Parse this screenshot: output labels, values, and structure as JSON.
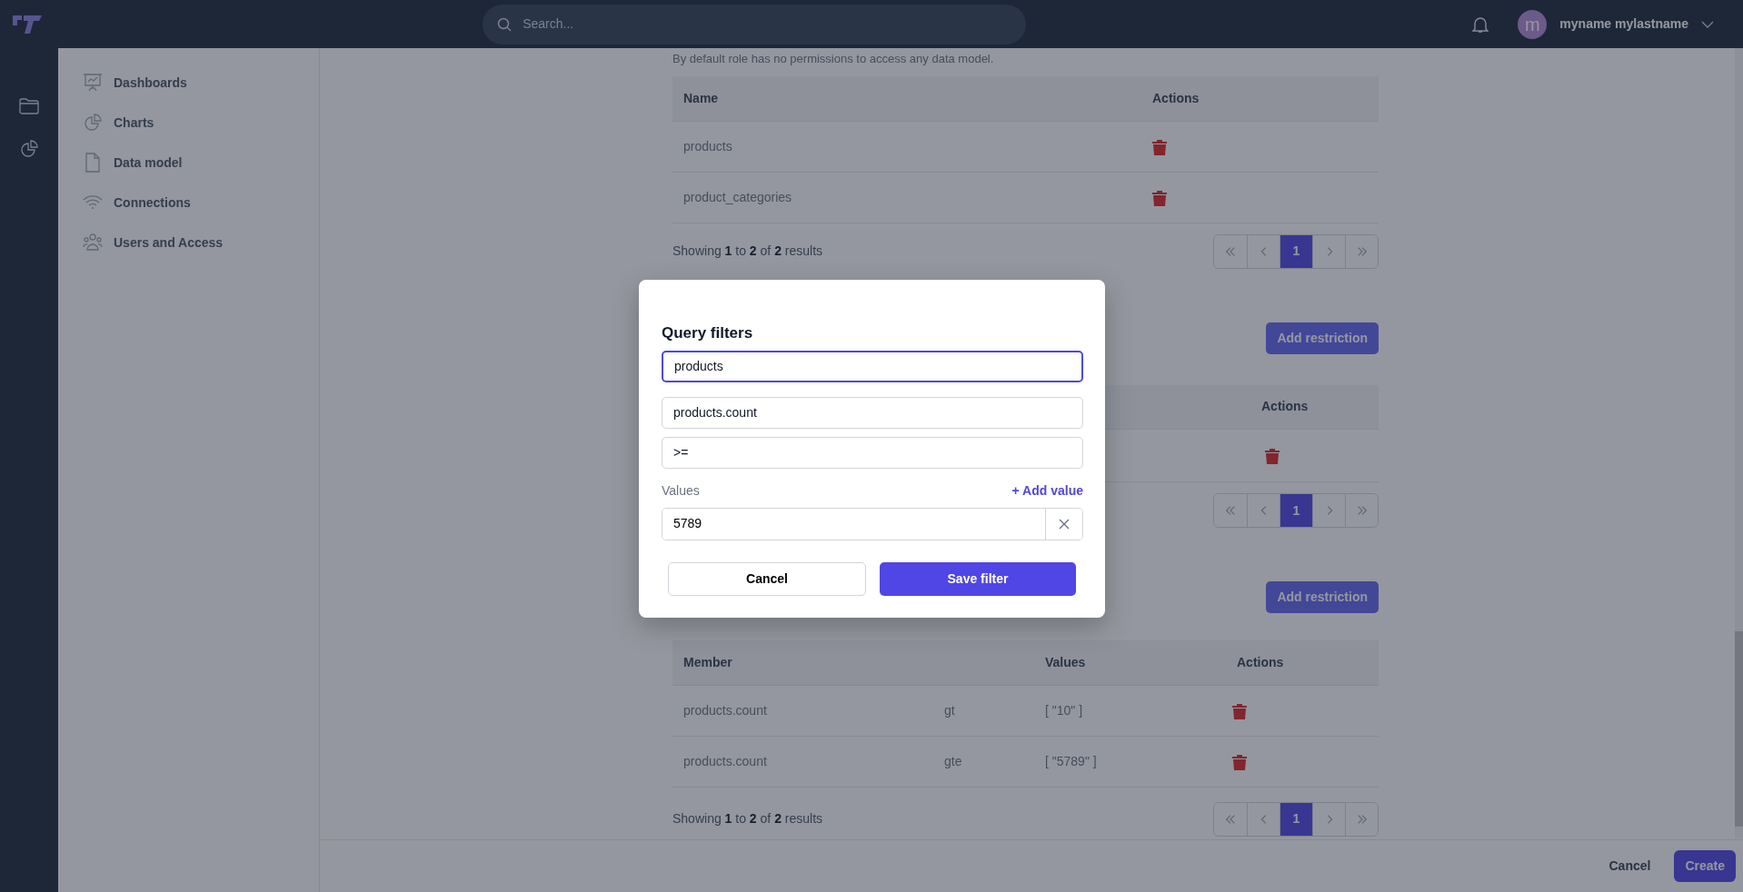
{
  "header": {
    "search": {
      "placeholder": "Search..."
    },
    "user": {
      "initial": "m",
      "name": "myname mylastname"
    }
  },
  "sidebar": {
    "items": [
      {
        "label": "Dashboards"
      },
      {
        "label": "Charts"
      },
      {
        "label": "Data model"
      },
      {
        "label": "Connections"
      },
      {
        "label": "Users and Access"
      }
    ]
  },
  "intro": "By default role has no permissions to access any data model.",
  "models_table": {
    "columns": [
      "Name",
      "Actions"
    ],
    "rows": [
      {
        "name": "products"
      },
      {
        "name": "product_categories"
      }
    ],
    "summary": "Showing **1** to **2** of **2** results",
    "pages": [
      {
        "label": "1",
        "selected": true
      }
    ]
  },
  "restrictions": {
    "add_button": "Add restriction",
    "columns": {
      "actions": "Actions"
    },
    "rows": [
      {
        "kind": "deletable"
      }
    ],
    "pages": [
      {
        "label": "1",
        "selected": true
      }
    ]
  },
  "filters": {
    "add_button": "Add restriction",
    "columns": {
      "member": "Member",
      "values": "Values",
      "actions": "Actions"
    },
    "rows": [
      {
        "member": "products.count",
        "operator": "gt",
        "values": "[ \"10\" ]"
      },
      {
        "member": "products.count",
        "operator": "gte",
        "values": "[ \"5789\" ]"
      }
    ],
    "summary": "Showing **1** to **2** of **2** results",
    "pages": [
      {
        "label": "1",
        "selected": true
      }
    ]
  },
  "footer": {
    "cancel": "Cancel",
    "create": "Create"
  },
  "modal": {
    "title": "Query filters",
    "fields": [
      {
        "value": "products",
        "focused": true
      },
      {
        "value": "products.count",
        "focused": false
      },
      {
        "value": ">=",
        "focused": false
      }
    ],
    "values_label": "Values",
    "add_value": "+ Add value",
    "values": [
      {
        "value": "5789"
      }
    ],
    "cancel": "Cancel",
    "save": "Save filter"
  }
}
